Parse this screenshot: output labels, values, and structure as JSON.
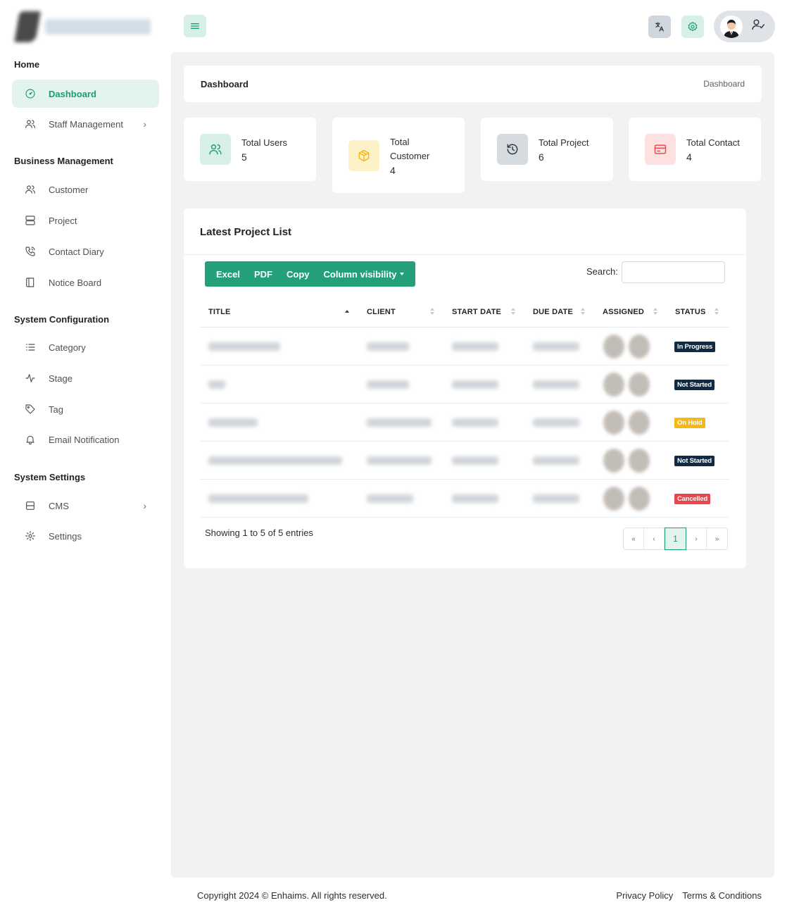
{
  "sidebar": {
    "sections": [
      {
        "title": "Home"
      },
      {
        "title": "Business Management"
      },
      {
        "title": "System Configuration"
      },
      {
        "title": "System Settings"
      }
    ],
    "items": [
      {
        "label": "Dashboard",
        "icon": "gauge-icon",
        "active": true
      },
      {
        "label": "Staff Management",
        "icon": "users-icon",
        "chevron": "›"
      },
      {
        "label": "Customer",
        "icon": "users-icon"
      },
      {
        "label": "Project",
        "icon": "server-icon"
      },
      {
        "label": "Contact Diary",
        "icon": "phone-icon"
      },
      {
        "label": "Notice Board",
        "icon": "book-icon"
      },
      {
        "label": "Category",
        "icon": "list-icon"
      },
      {
        "label": "Stage",
        "icon": "activity-icon"
      },
      {
        "label": "Tag",
        "icon": "tag-icon"
      },
      {
        "label": "Email Notification",
        "icon": "bell-icon"
      },
      {
        "label": "CMS",
        "icon": "layout-icon",
        "chevron": "›"
      },
      {
        "label": "Settings",
        "icon": "gear-icon"
      }
    ]
  },
  "topbar": {
    "menu_icon": "menu-icon",
    "translate_icon": "translate-icon",
    "settings_icon": "gear-icon",
    "profile_icon": "user-check-icon"
  },
  "breadcrumb": {
    "title": "Dashboard",
    "current": "Dashboard"
  },
  "stats": [
    {
      "label": "Total Users",
      "value": "5",
      "icon": "users-icon",
      "bg": "#d8efe7",
      "color": "#1d9b74"
    },
    {
      "label": "Total Customer",
      "value": "4",
      "icon": "box-icon",
      "bg": "#fdf1c8",
      "color": "#f3b71a"
    },
    {
      "label": "Total Project",
      "value": "6",
      "icon": "history-icon",
      "bg": "#d6dbe0",
      "color": "#2b3540"
    },
    {
      "label": "Total Contact",
      "value": "4",
      "icon": "card-icon",
      "bg": "#fde0e0",
      "color": "#e8464a"
    }
  ],
  "project_list": {
    "title": "Latest Project List",
    "buttons": {
      "excel": "Excel",
      "pdf": "PDF",
      "copy": "Copy",
      "column_visibility": "Column visibility"
    },
    "search_label": "Search:",
    "columns": [
      "TITLE",
      "CLIENT",
      "START DATE",
      "DUE DATE",
      "ASSIGNED",
      "STATUS"
    ],
    "rows": [
      {
        "status": "In Progress",
        "status_color": "#0f2a44"
      },
      {
        "status": "Not Started",
        "status_color": "#0f2a44"
      },
      {
        "status": "On Hold",
        "status_color": "#f5b915"
      },
      {
        "status": "Not Started",
        "status_color": "#0f2a44"
      },
      {
        "status": "Cancelled",
        "status_color": "#e8464a"
      }
    ],
    "showing": "Showing 1 to 5 of 5 entries",
    "pagination": {
      "first": "«",
      "prev": "‹",
      "current": "1",
      "next": "›",
      "last": "»"
    }
  },
  "footer": {
    "copyright": "Copyright 2024 © Enhaims. All rights reserved.",
    "privacy": "Privacy Policy",
    "terms": "Terms & Conditions"
  },
  "colors": {
    "accent": "#23a07a",
    "main_bg": "#f0f2f4"
  }
}
